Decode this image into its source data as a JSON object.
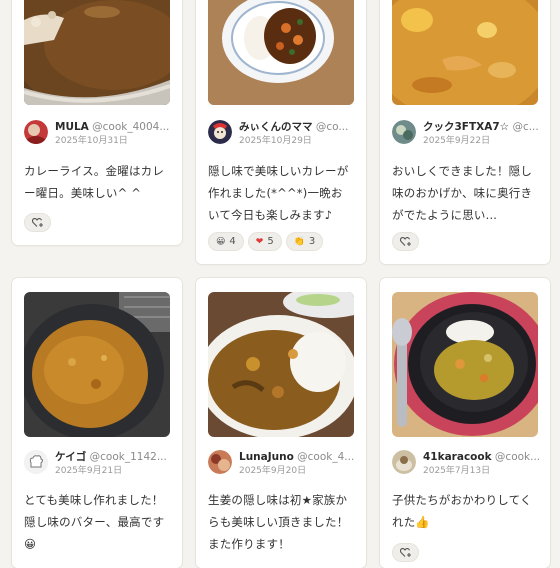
{
  "cards": [
    {
      "user_name": "MULA",
      "user_handle": "@cook_4004...",
      "date": "2025年10月31日",
      "text": "カレーライス。金曜はカレー曜日。美味しい^ ^",
      "reactions": []
    },
    {
      "user_name": "みぃくんのママ",
      "user_handle": "@co...",
      "date": "2025年10月29日",
      "text": "隠し味で美味しいカレーが作れました(*^^*)一晩おいて今日も楽しみます♪",
      "reactions": [
        {
          "icon": "smile-emoji-icon",
          "glyph": "😀",
          "count": "4"
        },
        {
          "icon": "heart-emoji-icon",
          "glyph": "❤",
          "count": "5"
        },
        {
          "icon": "clap-emoji-icon",
          "glyph": "👏",
          "count": "3"
        }
      ]
    },
    {
      "user_name": "クック3FTXA7☆",
      "user_handle": "@c...",
      "date": "2025年9月22日",
      "text": "おいしくできました！隠し味のおかげか、味に奥行きがでたように思い...",
      "reactions": []
    },
    {
      "user_name": "ケイゴ",
      "user_handle": "@cook_1142...",
      "date": "2025年9月21日",
      "text": "とても美味し作れました！ 隠し味のバター、最高です😀",
      "reactions": []
    },
    {
      "user_name": "LunaJuno",
      "user_handle": "@cook_4...",
      "date": "2025年9月20日",
      "text": "生姜の隠し味は初★家族からも美味しい頂きました！また作ります！",
      "reactions": []
    },
    {
      "user_name": "41karacook",
      "user_handle": "@cook...",
      "date": "2025年7月13日",
      "text": "子供たちがおかわりしてくれた👍",
      "reactions": []
    }
  ],
  "ui": {
    "add_reaction_icon": "heart-plus-icon",
    "colors": {
      "page_bg": "#f4f3ef",
      "card_bg": "#ffffff",
      "handle_gray": "#8a8a8a"
    }
  }
}
